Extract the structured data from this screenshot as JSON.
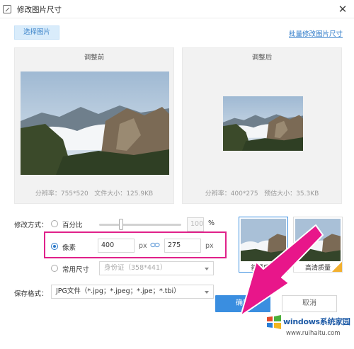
{
  "window": {
    "title": "修改图片尺寸",
    "close_glyph": "✕",
    "icon": "resize-icon"
  },
  "toolbar": {
    "pick_image": "选择图片",
    "batch_link": "批量修改图片尺寸"
  },
  "before": {
    "title": "调整前",
    "resolution_label": "分辨率：",
    "resolution": "755*520",
    "size_label": "文件大小：",
    "size": "125.9KB"
  },
  "after": {
    "title": "调整后",
    "resolution_label": "分辨率：",
    "resolution": "400*275",
    "size_label": "预估大小：",
    "size": "35.3KB"
  },
  "resize": {
    "label": "修改方式：",
    "percent": {
      "label": "百分比",
      "value": "100",
      "unit": "%",
      "slider_fraction": 0.25,
      "selected": false
    },
    "pixels": {
      "label": "像素",
      "width": "400",
      "height": "275",
      "unit": "px",
      "selected": true,
      "link_icon": "link-icon"
    },
    "common": {
      "label": "常用尺寸",
      "option": "身份证（358*441）",
      "selected": false
    }
  },
  "format": {
    "label": "保存格式：",
    "value": "JPG文件（*.jpg；*.jpeg；*.jpe；*.tbi）"
  },
  "quality": [
    {
      "label": "普通质量",
      "selected": true
    },
    {
      "label": "高清质量",
      "selected": false
    }
  ],
  "actions": {
    "ok": "确定",
    "cancel": "取消"
  },
  "watermark": {
    "name": "windows系统家园",
    "url": "www.ruihaitu.com"
  },
  "colors": {
    "accent": "#3a8ee0",
    "highlight": "#e0218a",
    "arrow": "#e8168a"
  }
}
